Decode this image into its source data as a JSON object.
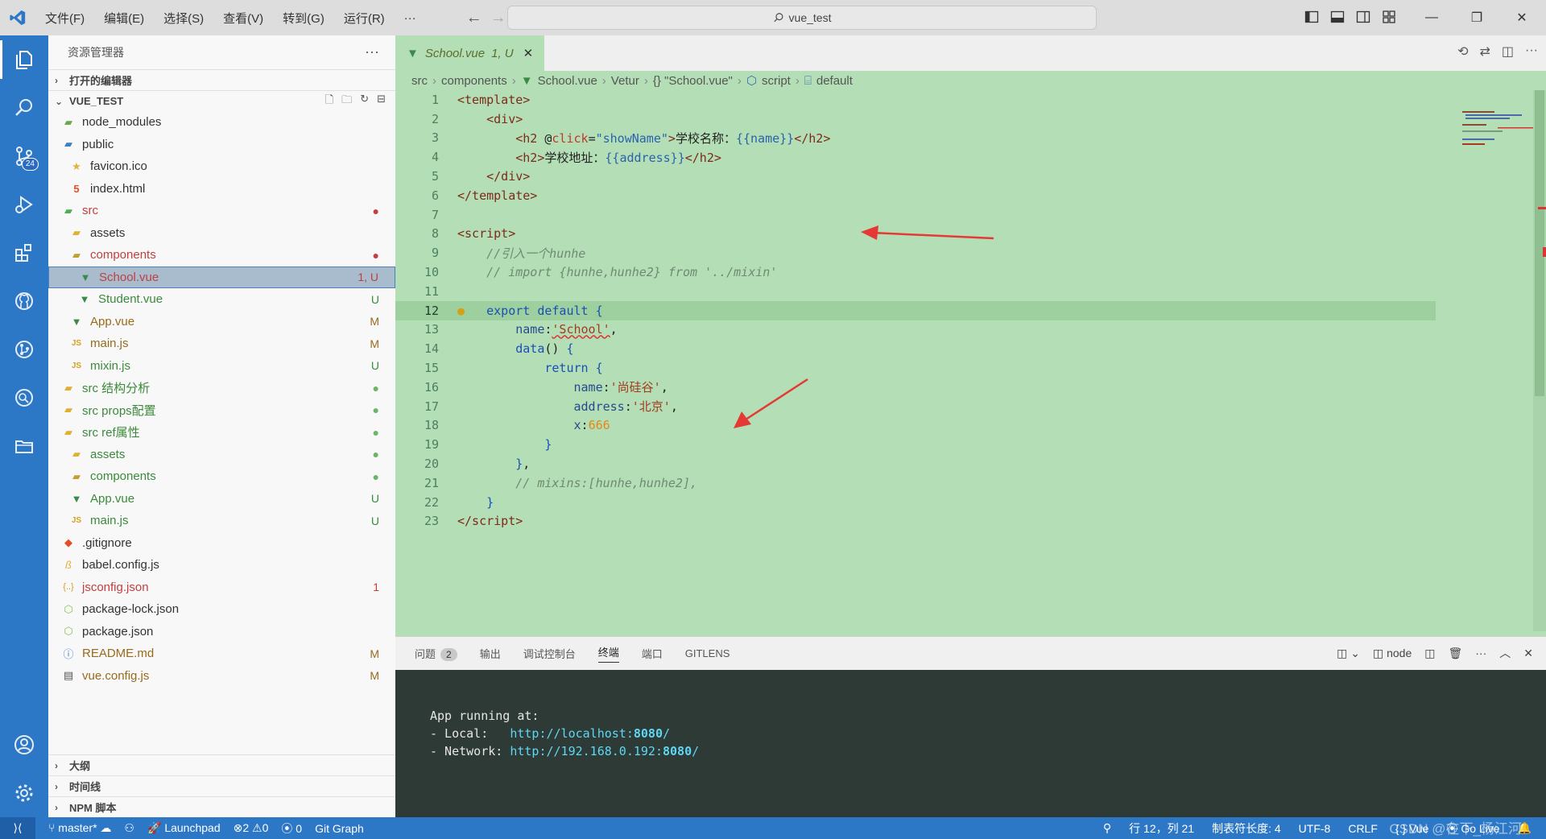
{
  "titlebar": {
    "menu": [
      "文件(F)",
      "编辑(E)",
      "选择(S)",
      "查看(V)",
      "转到(G)",
      "运行(R)",
      "···"
    ],
    "search": "vue_test"
  },
  "activity_badge": "24",
  "sidebar": {
    "title": "资源管理器",
    "open_editors": "打开的编辑器",
    "project": "VUE_TEST",
    "tree": [
      {
        "label": "node_modules",
        "status": "",
        "icon": "folder-node-icon"
      },
      {
        "label": "public",
        "status": "",
        "icon": "folder-public-icon"
      },
      {
        "label": "favicon.ico",
        "status": "",
        "icon": "star-file-icon"
      },
      {
        "label": "index.html",
        "status": "",
        "icon": "html-file-icon"
      },
      {
        "label": "src",
        "status": "●",
        "icon": "folder-src-icon"
      },
      {
        "label": "assets",
        "status": "",
        "icon": "folder-assets-icon"
      },
      {
        "label": "components",
        "status": "●",
        "icon": "folder-components-icon"
      },
      {
        "label": "School.vue",
        "status": "1, U",
        "icon": "vue-file-icon"
      },
      {
        "label": "Student.vue",
        "status": "U",
        "icon": "vue-file-icon"
      },
      {
        "label": "App.vue",
        "status": "M",
        "icon": "vue-file-icon"
      },
      {
        "label": "main.js",
        "status": "M",
        "icon": "js-file-icon"
      },
      {
        "label": "mixin.js",
        "status": "U",
        "icon": "js-file-icon"
      },
      {
        "label": "src 结构分析",
        "status": "●",
        "icon": "folder-icon"
      },
      {
        "label": "src props配置",
        "status": "●",
        "icon": "folder-icon"
      },
      {
        "label": "src ref属性",
        "status": "●",
        "icon": "folder-open-icon"
      },
      {
        "label": "assets",
        "status": "●",
        "icon": "folder-assets-icon"
      },
      {
        "label": "components",
        "status": "●",
        "icon": "folder-components-icon"
      },
      {
        "label": "App.vue",
        "status": "U",
        "icon": "vue-file-icon"
      },
      {
        "label": "main.js",
        "status": "U",
        "icon": "js-file-icon"
      },
      {
        "label": ".gitignore",
        "status": "",
        "icon": "git-file-icon"
      },
      {
        "label": "babel.config.js",
        "status": "",
        "icon": "babel-file-icon"
      },
      {
        "label": "jsconfig.json",
        "status": "1",
        "icon": "json-file-icon"
      },
      {
        "label": "package-lock.json",
        "status": "",
        "icon": "npm-file-icon"
      },
      {
        "label": "package.json",
        "status": "",
        "icon": "npm-file-icon"
      },
      {
        "label": "README.md",
        "status": "M",
        "icon": "info-file-icon"
      },
      {
        "label": "vue.config.js",
        "status": "M",
        "icon": "config-file-icon"
      }
    ],
    "sections_bottom": [
      "大纲",
      "时间线",
      "NPM 脚本"
    ]
  },
  "editor": {
    "tab_label": "School.vue",
    "tab_status": "1, U",
    "breadcrumb": [
      "src",
      "components",
      "School.vue",
      "Vetur",
      "{} \"School.vue\"",
      "script",
      "default"
    ],
    "line_numbers": [
      "1",
      "2",
      "3",
      "4",
      "5",
      "6",
      "7",
      "8",
      "9",
      "10",
      "11",
      "12",
      "13",
      "14",
      "15",
      "16",
      "17",
      "18",
      "19",
      "20",
      "21",
      "22",
      "23"
    ],
    "current_line": "12"
  },
  "panel": {
    "tabs": [
      "问题",
      "输出",
      "调试控制台",
      "终端",
      "端口",
      "GITLENS"
    ],
    "problems_count": "2",
    "terminal_name": "node",
    "terminal_lines": {
      "heading": "App running at:",
      "local_label": "- Local:   ",
      "local_url": "http://localhost:",
      "local_port": "8080",
      "network_label": "- Network: ",
      "network_url": "http://192.168.0.192:",
      "network_port": "8080",
      "trail": "/"
    }
  },
  "statusbar": {
    "branch": "master*",
    "launchpad": "Launchpad",
    "errors": "2",
    "warnings": "0",
    "ports": "0",
    "git_graph": "Git Graph",
    "position": "行 12，列 21",
    "tab_size": "制表符长度: 4",
    "encoding": "UTF-8",
    "eol": "CRLF",
    "language": "Vue",
    "go_live": "Go Live",
    "watermark": "CSDN @在下_杨江河"
  },
  "colors": {
    "activity_bar": "#2c78c6",
    "editor_bg": "#b4deb5",
    "terminal_bg": "#2d3a35"
  }
}
